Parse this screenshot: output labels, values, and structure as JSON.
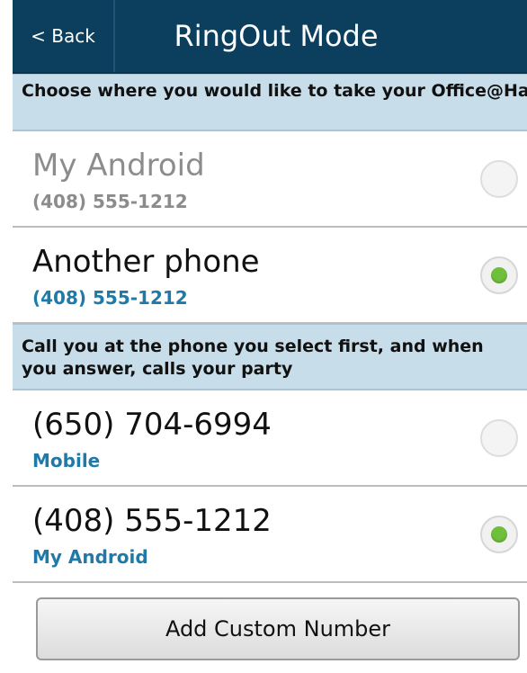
{
  "header": {
    "back_label": "< Back",
    "title": "RingOut Mode"
  },
  "section_location": {
    "text": "Choose where you would like to take your Office@Hand calls:"
  },
  "location_options": [
    {
      "name": "My Android",
      "number": "(408) 555-1212",
      "selected": false,
      "enabled": false
    },
    {
      "name": "Another phone",
      "number": "(408) 555-1212",
      "selected": true,
      "enabled": true
    }
  ],
  "section_callfirst": {
    "text": "Call you at the phone you select first, and when you answer, calls your party"
  },
  "phone_options": [
    {
      "number": "(650) 704-6994",
      "label": "Mobile",
      "selected": false
    },
    {
      "number": "(408) 555-1212",
      "label": "My Android",
      "selected": true
    }
  ],
  "add_button_label": "Add Custom Number",
  "colors": {
    "header_bg": "#0c3f5d",
    "section_bg": "#c7dde9",
    "accent": "#1f7aa8",
    "radio_checked": "#6fbf3c"
  }
}
